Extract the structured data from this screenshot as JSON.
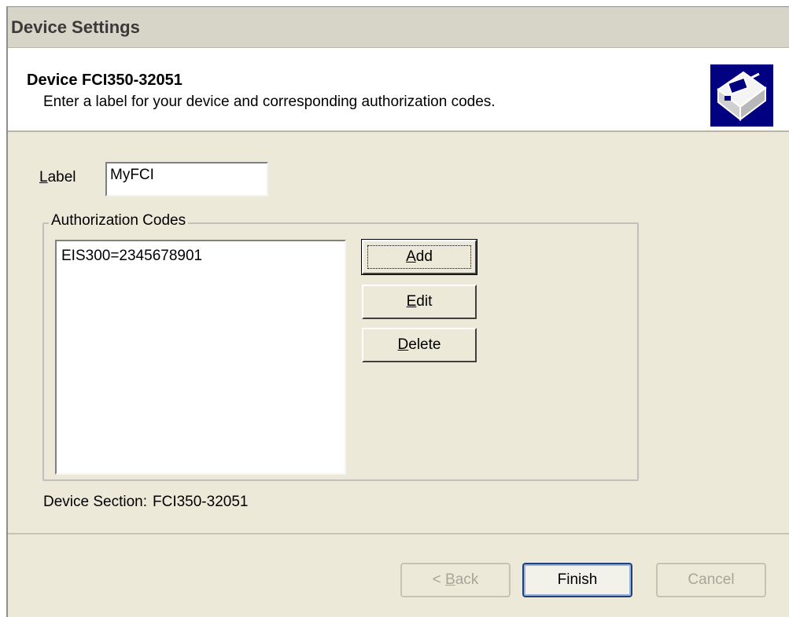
{
  "window": {
    "title": "Device Settings"
  },
  "header": {
    "title": "Device FCI350-32051",
    "subtitle": "Enter a label for your device and corresponding authorization codes.",
    "icon": "device-icon"
  },
  "form": {
    "label_caption_mnemonic": "L",
    "label_caption_rest": "abel",
    "label_value": "MyFCI",
    "auth_group_title": "Authorization Codes",
    "auth_codes": [
      "EIS300=2345678901"
    ],
    "buttons": {
      "add_mnemonic": "A",
      "add_rest": "dd",
      "edit_mnemonic": "E",
      "edit_rest": "dit",
      "delete_mnemonic": "D",
      "delete_rest": "elete"
    },
    "device_section_caption": "Device Section:",
    "device_section_value": "FCI350-32051"
  },
  "footer": {
    "back_prefix": "< ",
    "back_mnemonic": "B",
    "back_rest": "ack",
    "finish_label": "Finish",
    "cancel_label": "Cancel"
  },
  "colors": {
    "dialog_background": "#ece9d8",
    "header_background": "#ffffff",
    "icon_background": "#000080",
    "disabled_text": "#a8a59a"
  }
}
